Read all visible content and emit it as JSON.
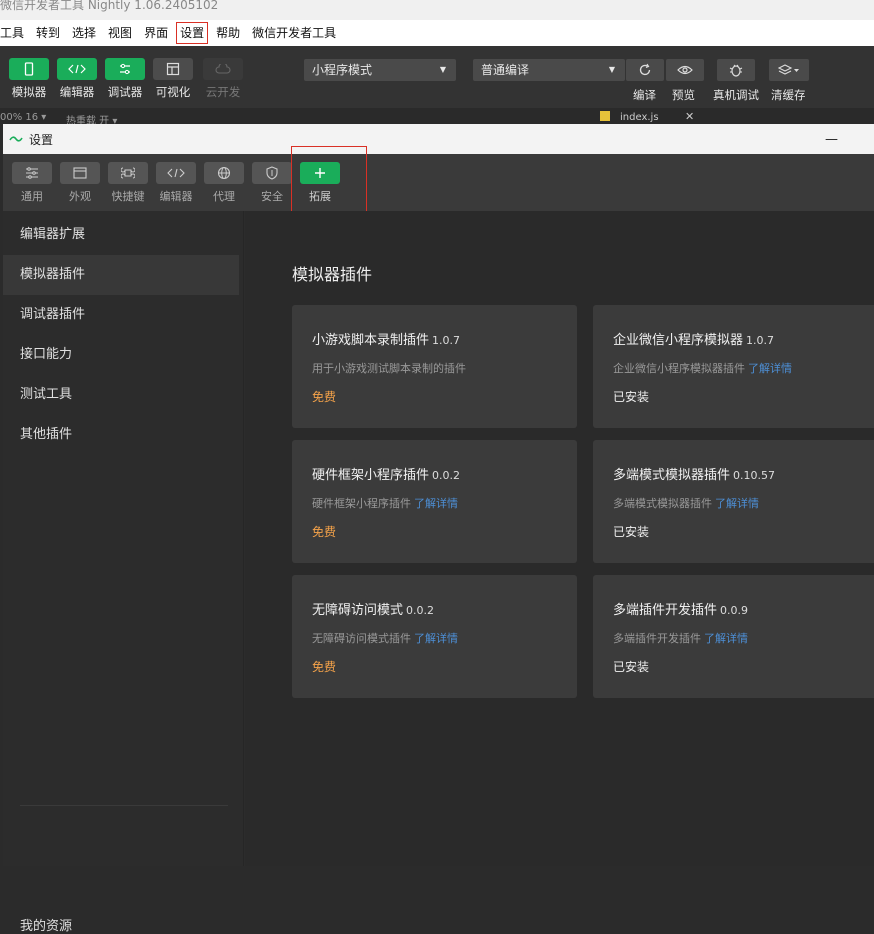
{
  "app_title": "微信开发者工具 Nightly 1.06.2405102",
  "menu": [
    "工具",
    "转到",
    "选择",
    "视图",
    "界面",
    "设置",
    "帮助",
    "微信开发者工具"
  ],
  "toolbar": {
    "left_buttons": [
      {
        "label": "模拟器",
        "icon": "phone-icon"
      },
      {
        "label": "编辑器",
        "icon": "code-icon"
      },
      {
        "label": "调试器",
        "icon": "debug-icon"
      },
      {
        "label": "可视化",
        "icon": "layout-icon"
      },
      {
        "label": "云开发",
        "icon": "cloud-icon"
      }
    ],
    "mode_select": "小程序模式",
    "compile_select": "普通编译",
    "right_buttons": [
      {
        "label": "编译",
        "icon": "refresh-icon"
      },
      {
        "label": "预览",
        "icon": "eye-icon"
      },
      {
        "label": "真机调试",
        "icon": "bug-icon"
      },
      {
        "label": "清缓存",
        "icon": "layers-icon"
      }
    ]
  },
  "ide_strip": {
    "left": "00% 16 ▾",
    "mid": "热重载 开 ▾",
    "file": "index.js"
  },
  "window": {
    "title": "设置",
    "tabs": [
      {
        "label": "通用",
        "icon": "sliders-icon"
      },
      {
        "label": "外观",
        "icon": "window-icon"
      },
      {
        "label": "快捷键",
        "icon": "command-icon"
      },
      {
        "label": "编辑器",
        "icon": "code-icon"
      },
      {
        "label": "代理",
        "icon": "globe-icon"
      },
      {
        "label": "安全",
        "icon": "shield-icon"
      },
      {
        "label": "拓展",
        "icon": "plus-icon"
      }
    ],
    "sidebar": [
      "编辑器扩展",
      "模拟器插件",
      "调试器插件",
      "接口能力",
      "测试工具",
      "其他插件"
    ],
    "sidebar_bottom": "我的资源",
    "main_title": "模拟器插件",
    "cards": [
      {
        "name": "小游戏脚本录制插件",
        "version": "1.0.7",
        "desc": "用于小游戏测试脚本录制的插件",
        "link": "",
        "state": "免费"
      },
      {
        "name": "企业微信小程序模拟器",
        "version": "1.0.7",
        "desc": "企业微信小程序模拟器插件",
        "link": "了解详情",
        "state": "已安装"
      },
      {
        "name": "硬件框架小程序插件",
        "version": "0.0.2",
        "desc": "硬件框架小程序插件",
        "link": "了解详情",
        "state": "免费"
      },
      {
        "name": "多端模式模拟器插件",
        "version": "0.10.57",
        "desc": "多端模式模拟器插件",
        "link": "了解详情",
        "state": "已安装"
      },
      {
        "name": "无障碍访问模式",
        "version": "0.0.2",
        "desc": "无障碍访问模式插件",
        "link": "了解详情",
        "state": "免费"
      },
      {
        "name": "多端插件开发插件",
        "version": "0.0.9",
        "desc": "多端插件开发插件",
        "link": "了解详情",
        "state": "已安装"
      }
    ]
  },
  "colors": {
    "accent_green": "#1aad5a",
    "highlight_red": "#d93025",
    "free_orange": "#f5a34a",
    "link_blue": "#4d8fd6"
  }
}
